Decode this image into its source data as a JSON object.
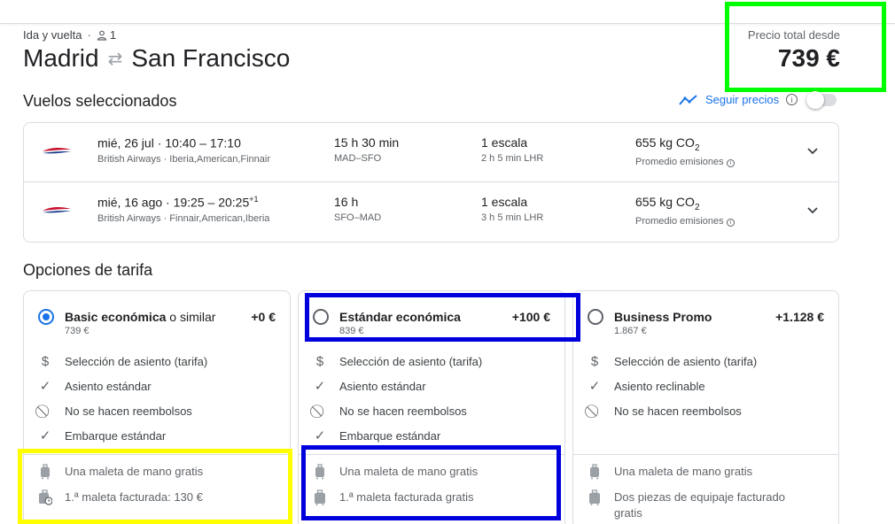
{
  "trip": {
    "type": "Ida y vuelta",
    "separator": "·",
    "passengers": "1",
    "origin": "Madrid",
    "destination": "San Francisco"
  },
  "total": {
    "label": "Precio total desde",
    "price": "739 €"
  },
  "selected_section": {
    "title": "Vuelos seleccionados",
    "track_label": "Seguir precios",
    "info_glyph": "i"
  },
  "flights": [
    {
      "date_time": "mié, 26 jul  ·  10:40 – 17:10",
      "day_offset": "",
      "airlines": "British Airways · Iberia,American,Finnair",
      "duration": "15 h 30 min",
      "route": "MAD–SFO",
      "stops": "1 escala",
      "layover": "2 h 5 min LHR",
      "emissions_value": "655 kg CO",
      "emissions_sub": "2",
      "emissions_label": "Promedio emisiones"
    },
    {
      "date_time": "mié, 16 ago  ·  19:25 – 20:25",
      "day_offset": "+1",
      "airlines": "British Airways · Finnair,American,Iberia",
      "duration": "16 h",
      "route": "SFO–MAD",
      "stops": "1 escala",
      "layover": "3 h 5 min LHR",
      "emissions_value": "655 kg CO",
      "emissions_sub": "2",
      "emissions_label": "Promedio emisiones"
    }
  ],
  "fares_section": {
    "title": "Opciones de tarifa"
  },
  "fares": [
    {
      "name": "Basic económica",
      "name_suffix": " o similar",
      "delta": "+0 €",
      "price": "739 €",
      "selected": true,
      "features": [
        {
          "icon": "dollar-icon",
          "text": "Selección de asiento (tarifa)"
        },
        {
          "icon": "check-icon",
          "text": "Asiento estándar"
        },
        {
          "icon": "no-icon",
          "text": "No se hacen reembolsos"
        },
        {
          "icon": "check-icon",
          "text": "Embarque estándar"
        }
      ],
      "bags": [
        {
          "icon": "carry-on-bag-icon",
          "text": "Una maleta de mano gratis"
        },
        {
          "icon": "checked-bag-fee-icon",
          "text": "1.ª maleta facturada: 130 €"
        }
      ]
    },
    {
      "name": "Estándar económica",
      "name_suffix": "",
      "delta": "+100 €",
      "price": "839 €",
      "selected": false,
      "features": [
        {
          "icon": "dollar-icon",
          "text": "Selección de asiento (tarifa)"
        },
        {
          "icon": "check-icon",
          "text": "Asiento estándar"
        },
        {
          "icon": "no-icon",
          "text": "No se hacen reembolsos"
        },
        {
          "icon": "check-icon",
          "text": "Embarque estándar"
        }
      ],
      "bags": [
        {
          "icon": "carry-on-bag-icon",
          "text": "Una maleta de mano gratis"
        },
        {
          "icon": "checked-bag-icon",
          "text": "1.ª maleta facturada gratis"
        }
      ]
    },
    {
      "name": "Business Promo",
      "name_suffix": "",
      "delta": "+1.128 €",
      "price": "1.867 €",
      "selected": false,
      "features": [
        {
          "icon": "dollar-icon",
          "text": "Selección de asiento (tarifa)"
        },
        {
          "icon": "check-icon",
          "text": "Asiento reclinable"
        },
        {
          "icon": "no-icon",
          "text": "No se hacen reembolsos"
        }
      ],
      "bags": [
        {
          "icon": "carry-on-bag-icon",
          "text": "Una maleta de mano gratis"
        },
        {
          "icon": "checked-bag-icon",
          "text": "Dos piezas de equipaje facturado gratis"
        }
      ]
    }
  ],
  "colors": {
    "accent": "#1a73e8",
    "highlight_green": "#00ff00",
    "highlight_yellow": "#ffff00",
    "highlight_blue": "#0000dd"
  }
}
